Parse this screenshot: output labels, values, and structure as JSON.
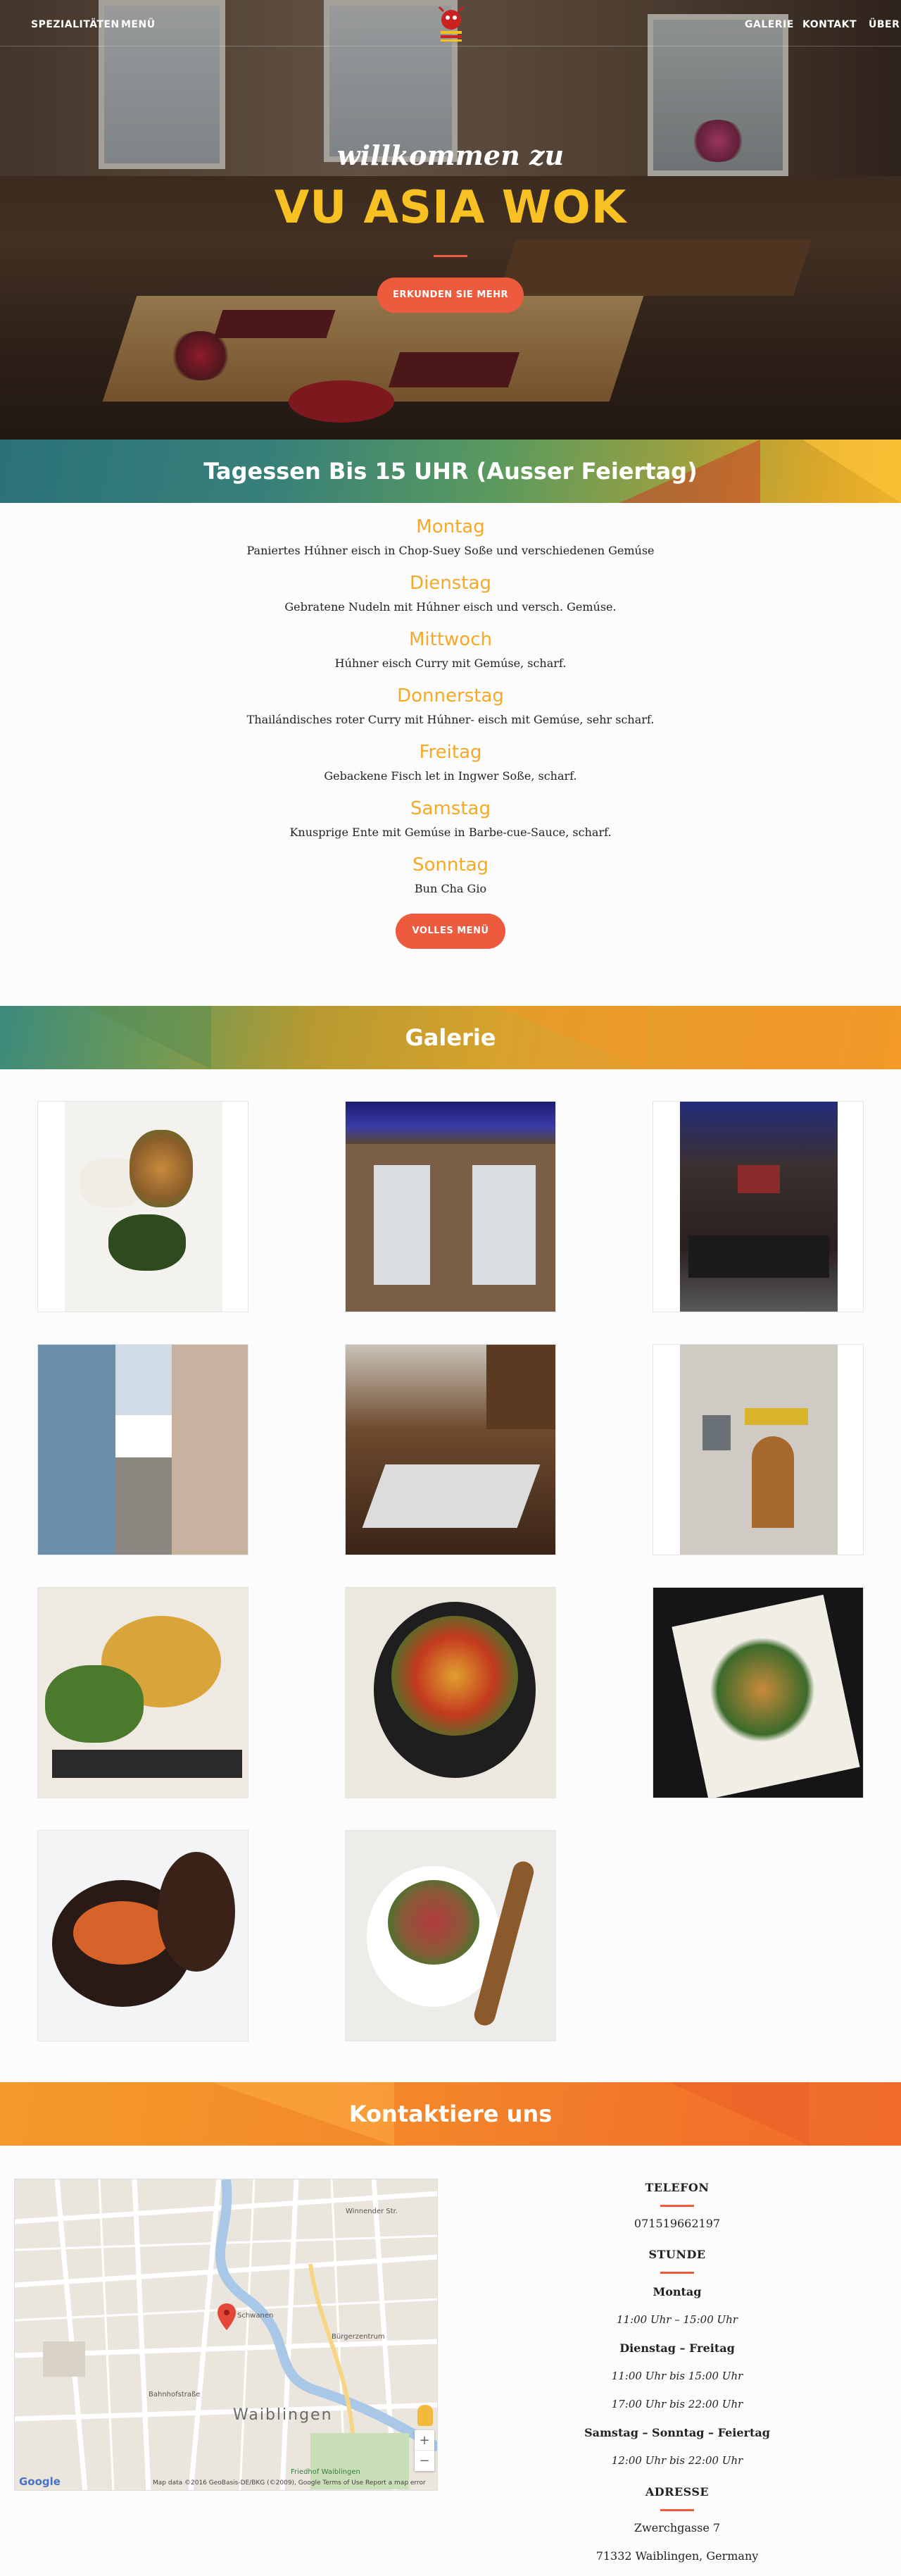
{
  "nav": {
    "left": [
      "SPEZIALITÄTEN",
      "MENÜ"
    ],
    "right": [
      "GALERIE",
      "KONTAKT",
      "ÜBER"
    ]
  },
  "hero": {
    "script": "willkommen zu",
    "title": "VU ASIA WOK",
    "cta": "ERKUNDEN SIE MEHR"
  },
  "tagessen": {
    "title": "Tagessen Bis 15 UHR (Ausser Feiertag)",
    "days": [
      {
        "day": "Montag",
        "dish": "Paniertes Húhner eisch in Chop-Suey Soße und verschiedenen Gemúse"
      },
      {
        "day": "Dienstag",
        "dish": "Gebratene Nudeln mit Húhner eisch und versch. Gemúse."
      },
      {
        "day": "Mittwoch",
        "dish": "Húhner eisch Curry mit Gemúse, scharf."
      },
      {
        "day": "Donnerstag",
        "dish": "Thailándisches roter Curry mit Húhner- eisch mit Gemúse, sehr scharf."
      },
      {
        "day": "Freitag",
        "dish": "Gebackene Fisch let in Ingwer Soße, scharf."
      },
      {
        "day": "Samstag",
        "dish": "Knusprige Ente mit Gemúse in Barbe-cue-Sauce, scharf."
      },
      {
        "day": "Sonntag",
        "dish": "Bun Cha Gio"
      }
    ],
    "button": "VOLLES MENÜ"
  },
  "galerie": {
    "title": "Galerie"
  },
  "kontakt": {
    "title": "Kontaktiere uns",
    "telefon_label": "TELEFON",
    "telefon": "071519662197",
    "stunde_label": "STUNDE",
    "hours": [
      {
        "day": "Montag",
        "times": [
          "11:00 Uhr – 15:00 Uhr"
        ]
      },
      {
        "day": "Dienstag – Freitag",
        "times": [
          "11:00 Uhr bis 15:00 Uhr",
          "17:00 Uhr bis 22:00 Uhr"
        ]
      },
      {
        "day": "Samstag – Sonntag – Feiertag",
        "times": [
          "12:00 Uhr bis 22:00 Uhr"
        ]
      }
    ],
    "adresse_label": "ADRESSE",
    "address": [
      "Zwerchgasse 7",
      "71332 Waiblingen, Germany"
    ]
  },
  "map": {
    "labels": [
      "Waiblingen",
      "Bürgerzentrum",
      "Schwanen",
      "Friedhof Waiblingen",
      "Bahnhofstraße",
      "Winnender Str."
    ],
    "attribution": "Map data ©2016 GeoBasis-DE/BKG (©2009), Google   Terms of Use   Report a map error",
    "google": "Google",
    "zoom_in": "+",
    "zoom_out": "−"
  },
  "colors": {
    "accent": "#ee5a3e",
    "gold": "#f7c123",
    "menu_day": "#f6a928"
  }
}
